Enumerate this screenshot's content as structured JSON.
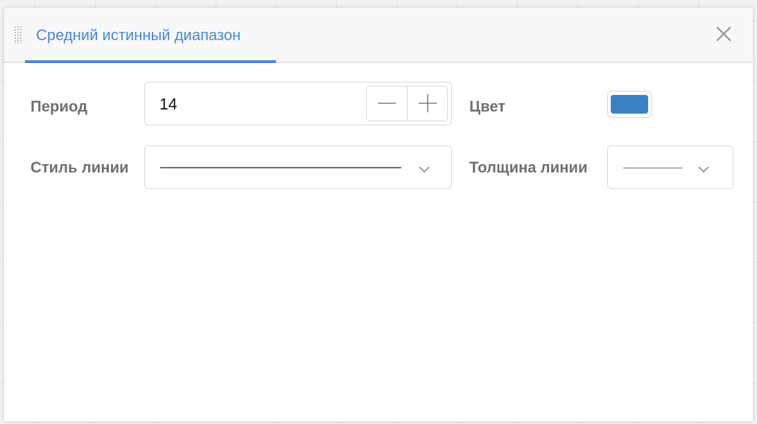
{
  "dialog": {
    "title": "Средний истинный диапазон",
    "close_icon": "close-icon",
    "drag_icon": "drag-handle-icon"
  },
  "fields": {
    "period": {
      "label": "Период",
      "value": "14",
      "decrement_icon": "minus-icon",
      "increment_icon": "plus-icon"
    },
    "color": {
      "label": "Цвет",
      "value": "#3b82c4"
    },
    "line_style": {
      "label": "Стиль линии",
      "selected": "solid",
      "icon": "chevron-down-icon"
    },
    "line_width": {
      "label": "Толщина линии",
      "selected": "thin",
      "icon": "chevron-down-icon"
    }
  },
  "colors": {
    "accent": "#4a87d6",
    "label": "#6f6f6f",
    "border": "#d6d6d6"
  }
}
